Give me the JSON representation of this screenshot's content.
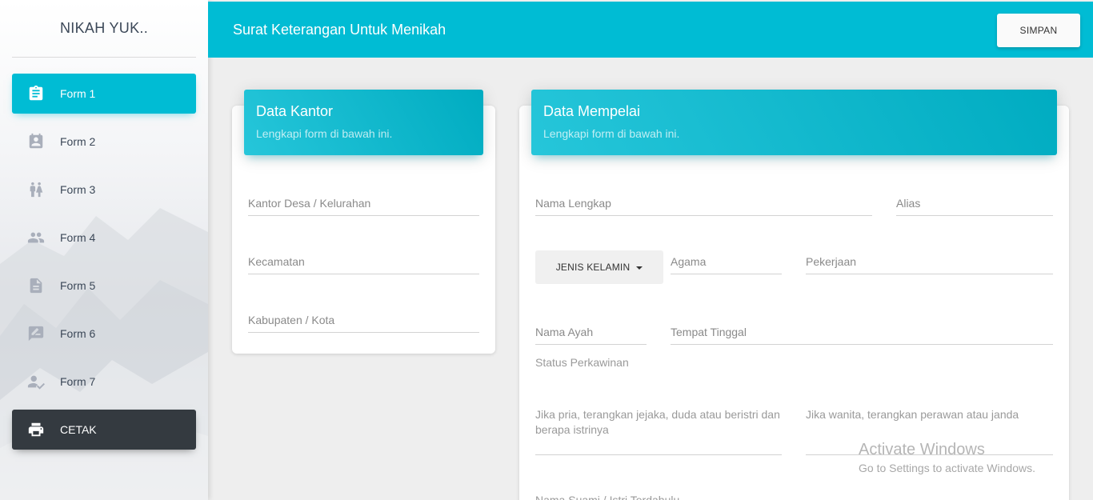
{
  "sidebar": {
    "brand": "NIKAH YUK..",
    "items": [
      {
        "label": "Form 1",
        "icon": "clipboard-icon"
      },
      {
        "label": "Form 2",
        "icon": "contact-card-icon"
      },
      {
        "label": "Form 3",
        "icon": "wc-people-icon"
      },
      {
        "label": "Form 4",
        "icon": "group-icon"
      },
      {
        "label": "Form 5",
        "icon": "document-icon"
      },
      {
        "label": "Form 6",
        "icon": "rate-review-icon"
      },
      {
        "label": "Form 7",
        "icon": "person-check-icon"
      },
      {
        "label": "CETAK",
        "icon": "print-icon"
      }
    ]
  },
  "header": {
    "title": "Surat Keterangan Untuk Menikah",
    "save_label": "SIMPAN"
  },
  "kantor": {
    "title": "Data Kantor",
    "subtitle": "Lengkapi form di bawah ini.",
    "fields": {
      "desa": "Kantor Desa / Kelurahan",
      "kecamatan": "Kecamatan",
      "kabupaten": "Kabupaten / Kota"
    }
  },
  "mempelai": {
    "title": "Data Mempelai",
    "subtitle": "Lengkapi form di bawah ini.",
    "fields": {
      "nama_lengkap": "Nama Lengkap",
      "alias": "Alias",
      "jenis_kelamin": "JENIS KELAMIN",
      "agama": "Agama",
      "pekerjaan": "Pekerjaan",
      "nama_ayah": "Nama Ayah",
      "tempat_tinggal": "Tempat Tinggal",
      "status_perkawinan": "Status Perkawinan",
      "jika_pria": "Jika pria, terangkan jejaka, duda atau beristri dan berapa istrinya",
      "jika_wanita": "Jika wanita, terangkan perawan atau janda",
      "nama_suami_istri": "Nama Suami / Istri Terdahulu"
    }
  },
  "watermark": {
    "line1": "Activate Windows",
    "line2": "Go to Settings to activate Windows."
  },
  "colors": {
    "accent": "#00bcd4",
    "dark_button": "#343a40"
  }
}
